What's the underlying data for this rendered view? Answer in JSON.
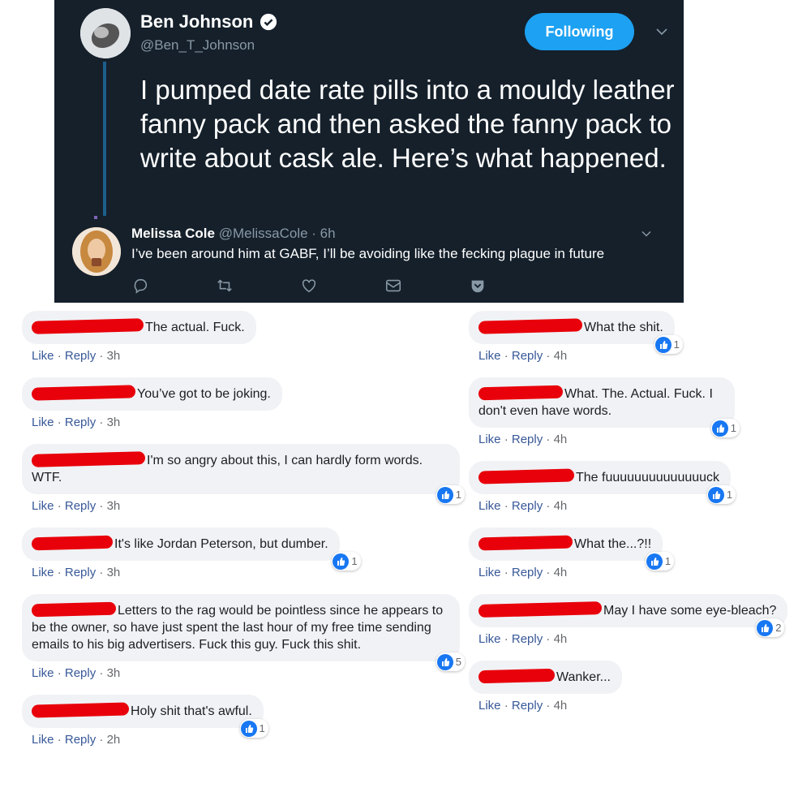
{
  "tweet": {
    "author_name": "Ben Johnson",
    "author_handle": "@Ben_T_Johnson",
    "follow_label": "Following",
    "text": "I pumped date rate pills into a mouldy leather fanny pack and then asked the fanny pack to write about cask ale. Here’s what happened.",
    "reply": {
      "name": "Melissa Cole",
      "handle_time": "@MelissaCole · 6h",
      "text": "I’ve been around him at GABF, I’ll be avoiding like the fecking plague in future"
    },
    "action_icons": [
      "reply-icon",
      "retweet-icon",
      "like-heart-icon",
      "message-icon",
      "bookmark-icon"
    ],
    "colors": {
      "background": "#15202b",
      "accent": "#1da1f2"
    }
  },
  "comments": {
    "like_label": "Like",
    "reply_label": "Reply",
    "left": [
      {
        "text": "The actual. Fuck.",
        "time": "3h",
        "reactions": ""
      },
      {
        "text": "You’ve got to be joking.",
        "time": "3h",
        "reactions": ""
      },
      {
        "text": "I'm so angry about this, I can hardly form words. WTF.",
        "time": "3h",
        "reactions": "1"
      },
      {
        "text": "It's like Jordan Peterson, but dumber.",
        "time": "3h",
        "reactions": "1"
      },
      {
        "text": "Letters to the rag would be pointless since he appears to be the owner, so have just spent the last hour of my free time sending emails to his big advertisers. Fuck this guy. Fuck this shit.",
        "time": "3h",
        "reactions": "5"
      },
      {
        "text": "Holy shit that's awful.",
        "time": "2h",
        "reactions": "1"
      }
    ],
    "right": [
      {
        "text": "What the shit.",
        "time": "4h",
        "reactions": "1"
      },
      {
        "text": "What. The. Actual. Fuck. I don't even have words.",
        "time": "4h",
        "reactions": "1"
      },
      {
        "text": "The fuuuuuuuuuuuuuuck",
        "time": "4h",
        "reactions": "1"
      },
      {
        "text": "What the...?!!",
        "time": "4h",
        "reactions": "1"
      },
      {
        "text": "May I have some eye-bleach?",
        "time": "4h",
        "reactions": "2"
      },
      {
        "text": "Wanker...",
        "time": "4h",
        "reactions": ""
      }
    ],
    "colors": {
      "bubble": "#f0f2f5",
      "link": "#385898",
      "redaction": "#e8000b",
      "like_badge": "#1877f2"
    }
  }
}
